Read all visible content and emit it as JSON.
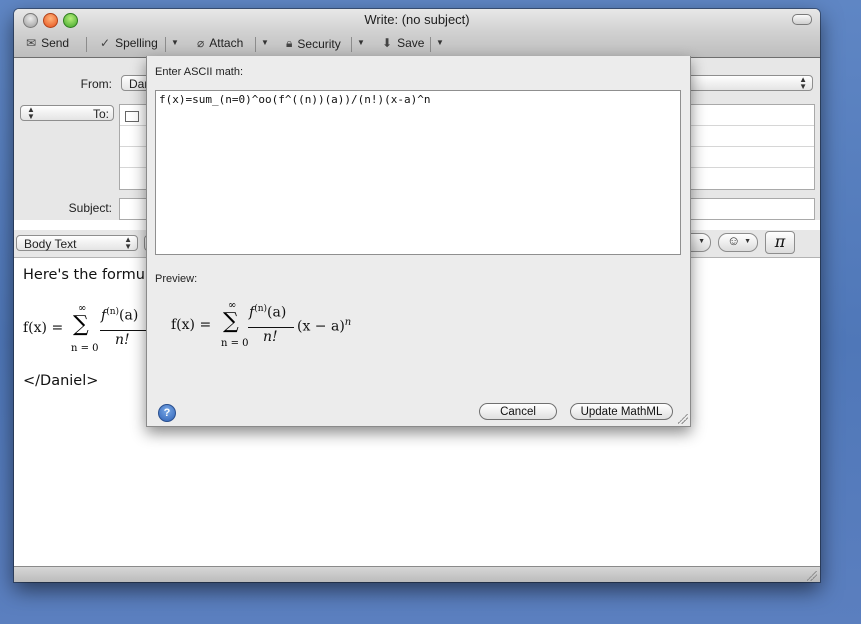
{
  "window": {
    "title": "Write: (no subject)"
  },
  "toolbar": {
    "send_label": "Send",
    "spelling_label": "Spelling",
    "attach_label": "Attach",
    "security_label": "Security",
    "save_label": "Save"
  },
  "headers": {
    "from_label": "From:",
    "from_value": "Dan",
    "to_type": "To:",
    "subject_label": "Subject:"
  },
  "format": {
    "style_value": "Body Text",
    "pi_label": "π"
  },
  "message": {
    "intro": "Here's the formul",
    "signature": "</Daniel>"
  },
  "formula": {
    "lhs": "f(x) =",
    "sigma": "∑",
    "upper": "∞",
    "lower": "n = 0",
    "numerator": "f",
    "superscript": "(n)",
    "numerator_arg": "(a)",
    "denominator": "n!",
    "tail": "(x − a)",
    "exponent": "n"
  },
  "dialog": {
    "input_label": "Enter ASCII math:",
    "input_value": "f(x)=sum_(n=0)^oo(f^((n))(a))/(n!)(x-a)^n",
    "preview_label": "Preview:",
    "cancel_label": "Cancel",
    "update_label": "Update MathML",
    "help_label": "?"
  }
}
